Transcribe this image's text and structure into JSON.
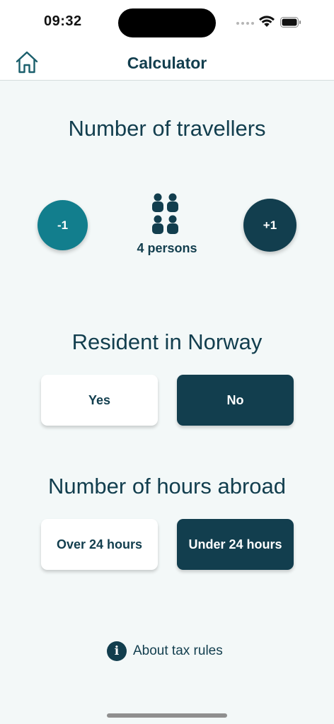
{
  "status_bar": {
    "time": "09:32",
    "icons": [
      "cellular-signal-icon",
      "wifi-icon",
      "battery-icon"
    ]
  },
  "navbar": {
    "title": "Calculator",
    "home_icon": "home-icon"
  },
  "travellers": {
    "heading": "Number of travellers",
    "decrement_label": "-1",
    "increment_label": "+1",
    "count_label": "4 persons",
    "persons_icon": "group-of-persons-icon"
  },
  "resident": {
    "heading": "Resident in Norway",
    "options": [
      "Yes",
      "No"
    ],
    "selected": "No"
  },
  "hours": {
    "heading": "Number of hours abroad",
    "options": [
      "Over 24 hours",
      "Under 24 hours"
    ],
    "selected": "Under 24 hours"
  },
  "footer": {
    "about_label": "About tax rules",
    "info_icon": "i"
  },
  "colors": {
    "primary_dark": "#123e4e",
    "accent_teal": "#127e8d",
    "background": "#f3f8f8"
  }
}
